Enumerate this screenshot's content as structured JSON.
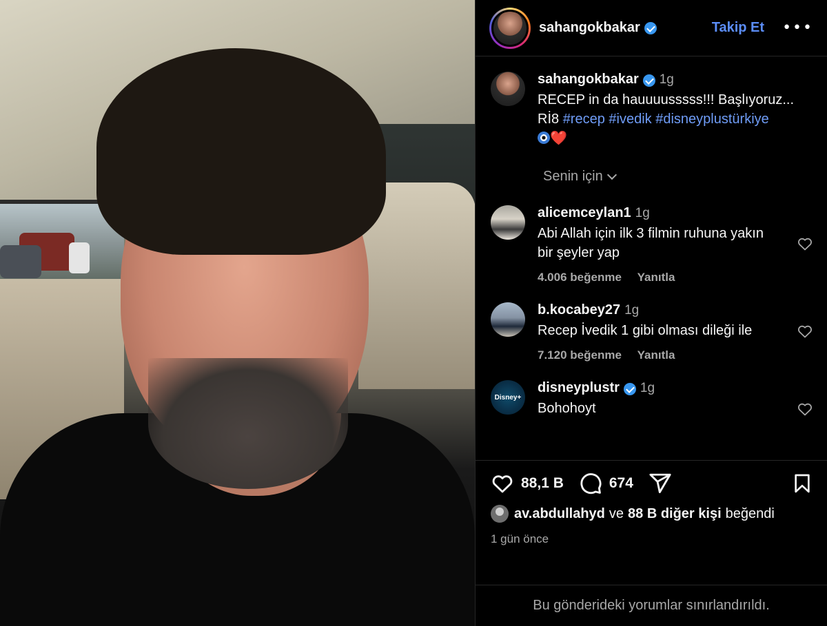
{
  "post": {
    "author": "sahangokbakar",
    "follow_label": "Takip Et",
    "more_label": "•••",
    "caption": {
      "author": "sahangokbakar",
      "time": "1g",
      "line1": "RECEP in da hauuuusssss!!! Başlıyoruz...",
      "line2_prefix": "Rİ8",
      "tags": [
        "#recep",
        "#ivedik",
        "#disneyplustürkiye"
      ],
      "emoji_heart": "❤️"
    },
    "for_you_label": "Senin için",
    "comments": [
      {
        "author": "alicemceylan1",
        "time": "1g",
        "text": "Abi Allah için ilk 3 filmin ruhuna yakın bir şeyler yap",
        "likes": "4.006 beğenme",
        "reply": "Yanıtla"
      },
      {
        "author": "b.kocabey27",
        "time": "1g",
        "text": "Recep İvedik 1 gibi olması dileği ile",
        "likes": "7.120 beğenme",
        "reply": "Yanıtla"
      },
      {
        "author": "disneyplustr",
        "time": "1g",
        "text": "Bohohoyt",
        "avatar_text": "Disney+"
      }
    ],
    "stats": {
      "likes": "88,1 B",
      "comments": "674"
    },
    "liked_by": {
      "user": "av.abdullahyd",
      "connector": "ve",
      "others": "88 B diğer kişi",
      "suffix": "beğendi"
    },
    "posted_ago": "1 gün önce",
    "restricted_notice": "Bu gönderideki yorumlar sınırlandırıldı."
  },
  "colors": {
    "accent": "#5b8df7",
    "verified": "#3897f0",
    "secondary_text": "#a8a8a8",
    "hashtag": "#6f9cf6"
  }
}
